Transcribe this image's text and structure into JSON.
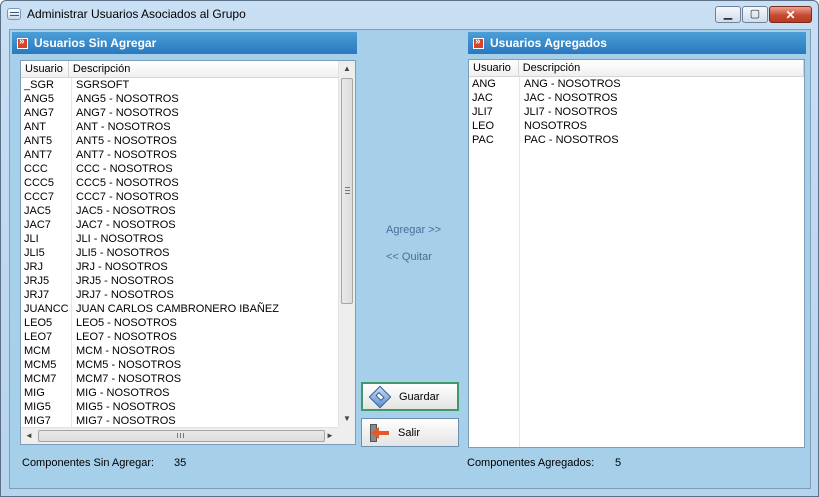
{
  "window": {
    "title": "Administrar Usuarios Asociados al Grupo",
    "minimize_glyph": "▁",
    "maximize_glyph": "▢",
    "close_glyph": "✕"
  },
  "left_panel": {
    "header": "Usuarios Sin Agregar",
    "columns": [
      "Usuario",
      "Descripción"
    ],
    "rows": [
      [
        "_SGR",
        "SGRSOFT"
      ],
      [
        "ANG5",
        "ANG5 - NOSOTROS"
      ],
      [
        "ANG7",
        "ANG7 - NOSOTROS"
      ],
      [
        "ANT",
        "ANT - NOSOTROS"
      ],
      [
        "ANT5",
        "ANT5 - NOSOTROS"
      ],
      [
        "ANT7",
        "ANT7 - NOSOTROS"
      ],
      [
        "CCC",
        "CCC - NOSOTROS"
      ],
      [
        "CCC5",
        "CCC5 - NOSOTROS"
      ],
      [
        "CCC7",
        "CCC7 - NOSOTROS"
      ],
      [
        "JAC5",
        "JAC5 - NOSOTROS"
      ],
      [
        "JAC7",
        "JAC7 - NOSOTROS"
      ],
      [
        "JLI",
        "JLI - NOSOTROS"
      ],
      [
        "JLI5",
        "JLI5 - NOSOTROS"
      ],
      [
        "JRJ",
        "JRJ - NOSOTROS"
      ],
      [
        "JRJ5",
        "JRJ5 - NOSOTROS"
      ],
      [
        "JRJ7",
        "JRJ7 - NOSOTROS"
      ],
      [
        "JUANCC",
        "JUAN CARLOS CAMBRONERO IBAÑEZ"
      ],
      [
        "LEO5",
        "LEO5 - NOSOTROS"
      ],
      [
        "LEO7",
        "LEO7 - NOSOTROS"
      ],
      [
        "MCM",
        "MCM - NOSOTROS"
      ],
      [
        "MCM5",
        "MCM5 - NOSOTROS"
      ],
      [
        "MCM7",
        "MCM7 - NOSOTROS"
      ],
      [
        "MIG",
        "MIG - NOSOTROS"
      ],
      [
        "MIG5",
        "MIG5 - NOSOTROS"
      ],
      [
        "MIG7",
        "MIG7 - NOSOTROS"
      ]
    ],
    "footer_label": "Componentes Sin Agregar:",
    "footer_count": "35"
  },
  "right_panel": {
    "header": "Usuarios Agregados",
    "columns": [
      "Usuario",
      "Descripción"
    ],
    "rows": [
      [
        "ANG",
        "ANG - NOSOTROS"
      ],
      [
        "JAC",
        "JAC - NOSOTROS"
      ],
      [
        "JLI7",
        "JLI7 - NOSOTROS"
      ],
      [
        "LEO",
        "NOSOTROS"
      ],
      [
        "PAC",
        "PAC - NOSOTROS"
      ]
    ],
    "footer_label": "Componentes Agregados:",
    "footer_count": "5"
  },
  "actions": {
    "add_label": "Agregar >>",
    "remove_label": "<< Quitar",
    "save_label": "Guardar",
    "exit_label": "Salir",
    "save_icon": "save-diamond-icon",
    "exit_icon": "exit-door-icon"
  },
  "scroll_glyphs": {
    "up": "▲",
    "down": "▼",
    "left": "◄",
    "right": "►"
  },
  "colors": {
    "panel_header": "#2a78c0",
    "client_bg": "#a6cfe9",
    "link_text": "#4a6f97",
    "close_button": "#c74a33"
  }
}
